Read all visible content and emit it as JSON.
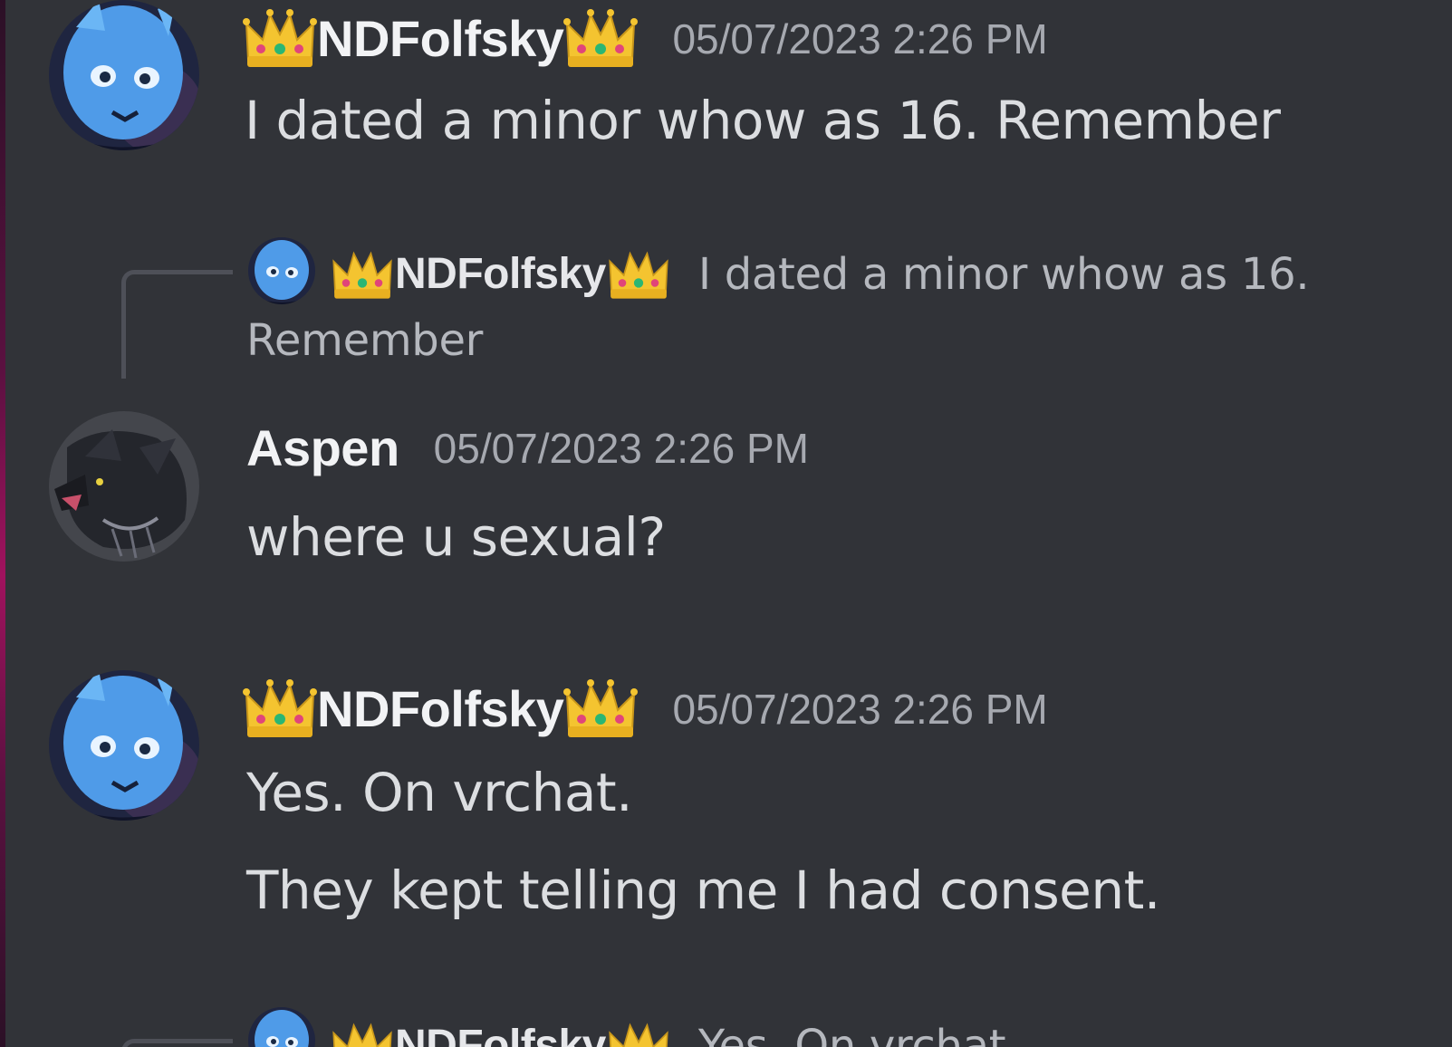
{
  "colors": {
    "background": "#313338",
    "username": "#f2f3f5",
    "timestamp": "#a6a9b0",
    "message": "#dcdee1",
    "reply_text": "#b5b8be",
    "accent_edge": "#a0125e"
  },
  "messages": [
    {
      "author": "NDFolfsky",
      "crowns": "crown-emoji",
      "timestamp": "05/07/2023 2:26 PM",
      "lines": [
        "I dated a minor whow as 16. Remember"
      ]
    },
    {
      "reply_to": {
        "author": "NDFolfsky",
        "preview_first": "I dated a minor whow as 16.",
        "preview_rest": "Remember"
      },
      "author": "Aspen",
      "timestamp": "05/07/2023 2:26 PM",
      "lines": [
        "where u sexual?"
      ]
    },
    {
      "author": "NDFolfsky",
      "timestamp": "05/07/2023 2:26 PM",
      "lines": [
        "Yes. On vrchat.",
        "They kept telling me I had consent."
      ]
    },
    {
      "reply_to": {
        "author": "NDFolfsky",
        "preview_first": "Yes. On vrchat."
      }
    }
  ]
}
